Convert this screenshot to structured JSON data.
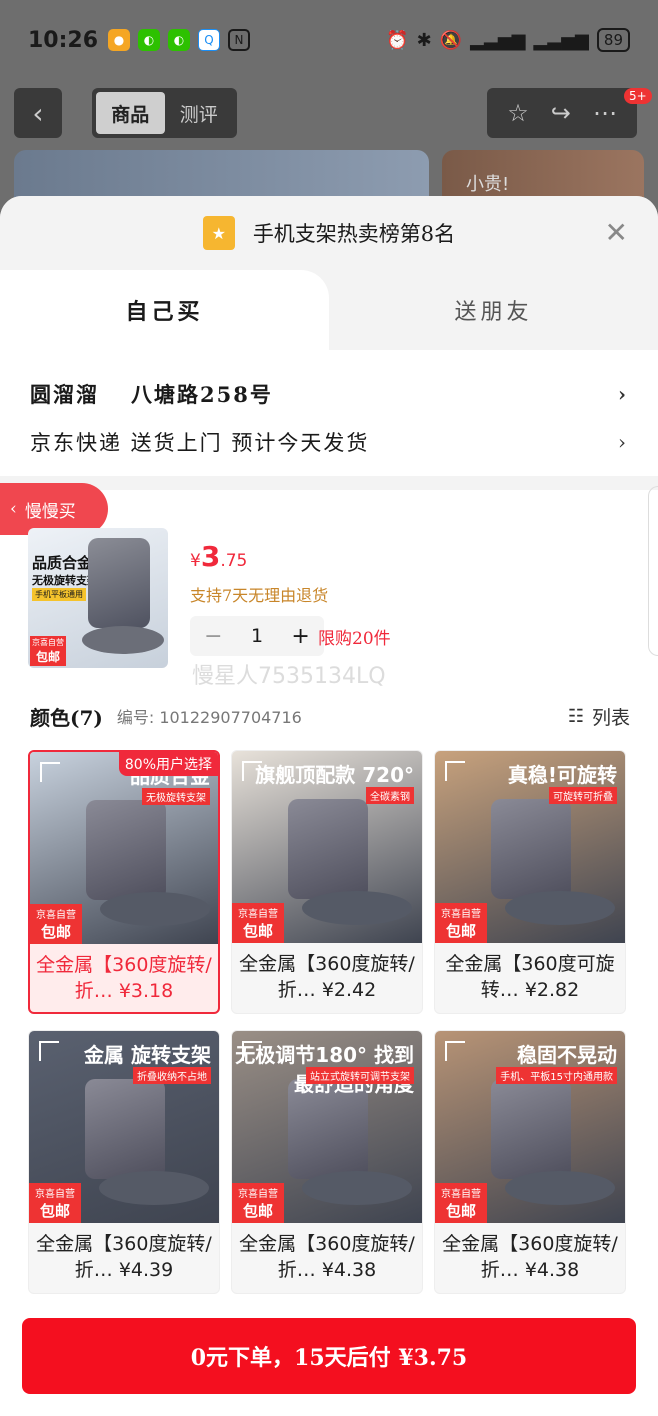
{
  "status_bar": {
    "time": "10:26",
    "battery": "89",
    "app_icons": [
      "weibo-icon",
      "wechat-icon",
      "wechat-icon",
      "qq-icon",
      "nfc-icon"
    ]
  },
  "header": {
    "tabs": [
      "商品",
      "测评"
    ],
    "badge": "5+",
    "hero_text": "小贵!"
  },
  "sheet": {
    "ranking": "手机支架热卖榜第8名",
    "tabs": [
      "自己买",
      "送朋友"
    ],
    "address_name": "圆溜溜",
    "address": "八塘路258号",
    "delivery": "京东快递 送货上门 预计今天发货",
    "slow_buy": "慢慢买"
  },
  "product": {
    "currency": "¥",
    "price_int": "3",
    "price_dec": ".75",
    "policy": "支持7天无理由退货",
    "quantity": "1",
    "limit": "限购20件",
    "watermark": "慢星人7535134LQ",
    "thumb_title": "品质合金",
    "thumb_sub": "无极旋转支架",
    "thumb_tag": "手机平板通用",
    "self_run": "京喜自营",
    "free_ship": "包邮"
  },
  "colors": {
    "label": "颜色(7)",
    "code": "编号: 10122907704716",
    "list_view": "列表",
    "selected_badge": "80%用户选择",
    "items": [
      {
        "title": "全金属【360度旋转/折… ¥3.18",
        "head": "品质合金",
        "sub": "无极旋转支架",
        "bg": "#c8d2de"
      },
      {
        "title": "全金属【360度旋转/折… ¥2.42",
        "head": "旗舰顶配款 720°",
        "sub": "全碳素钢",
        "bg": "#e8e2da"
      },
      {
        "title": "全金属【360度可旋转… ¥2.82",
        "head": "真稳!可旋转",
        "sub": "可旋转可折叠",
        "bg": "#c8a27d"
      },
      {
        "title": "全金属【360度旋转/折… ¥4.39",
        "head": "金属 旋转支架",
        "sub": "折叠收纳不占地",
        "bg": "#5a6170"
      },
      {
        "title": "全金属【360度旋转/折… ¥4.38",
        "head": "无极调节180° 找到最舒适的角度",
        "sub": "站立式旋转可调节支架",
        "bg": "#9a8f86"
      },
      {
        "title": "全金属【360度旋转/折… ¥4.38",
        "head": "稳固不晃动",
        "sub": "手机、平板15寸内通用款",
        "bg": "#b89476"
      }
    ]
  },
  "buy_button": "0元下单，15天后付 ¥3.75"
}
